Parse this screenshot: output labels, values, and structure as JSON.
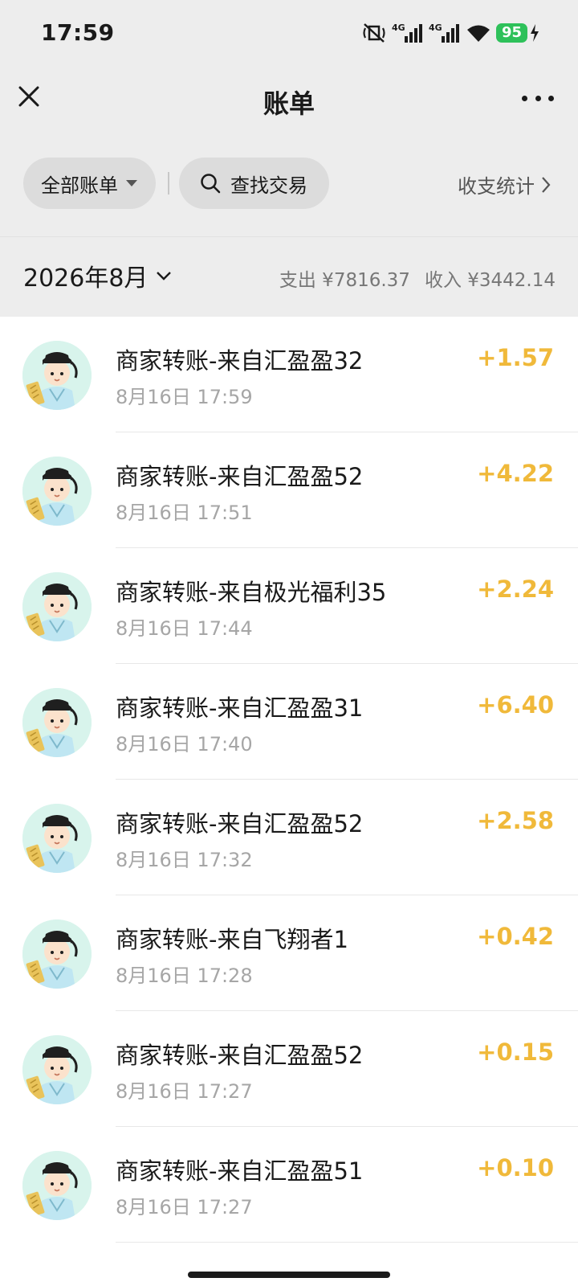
{
  "status_bar": {
    "time": "17:59",
    "battery": "95",
    "icons": [
      "mute-icon",
      "signal-4g-icon",
      "signal-4g-icon",
      "wifi-icon",
      "charging-icon"
    ],
    "net_label_1": "4G",
    "net_label_2": "4G"
  },
  "nav": {
    "title": "账单",
    "close_icon": "close-icon",
    "more_icon": "more-icon"
  },
  "filters": {
    "all_bills_label": "全部账单",
    "search_label": "查找交易",
    "stats_label": "收支统计"
  },
  "month": {
    "label": "2026年8月",
    "expense": "支出 ¥7816.37",
    "income": "收入 ¥3442.14"
  },
  "transactions": [
    {
      "name": "商家转账-来自汇盈盈32",
      "time": "8月16日 17:59",
      "amount": "+1.57"
    },
    {
      "name": "商家转账-来自汇盈盈52",
      "time": "8月16日 17:51",
      "amount": "+4.22"
    },
    {
      "name": "商家转账-来自极光福利35",
      "time": "8月16日 17:44",
      "amount": "+2.24"
    },
    {
      "name": "商家转账-来自汇盈盈31",
      "time": "8月16日 17:40",
      "amount": "+6.40"
    },
    {
      "name": "商家转账-来自汇盈盈52",
      "time": "8月16日 17:32",
      "amount": "+2.58"
    },
    {
      "name": "商家转账-来自飞翔者1",
      "time": "8月16日 17:28",
      "amount": "+0.42"
    },
    {
      "name": "商家转账-来自汇盈盈52",
      "time": "8月16日 17:27",
      "amount": "+0.15"
    },
    {
      "name": "商家转账-来自汇盈盈51",
      "time": "8月16日 17:27",
      "amount": "+0.10"
    }
  ],
  "colors": {
    "amount_income": "#f0b93a",
    "header_bg": "#ededed",
    "battery": "#2ec15a"
  }
}
